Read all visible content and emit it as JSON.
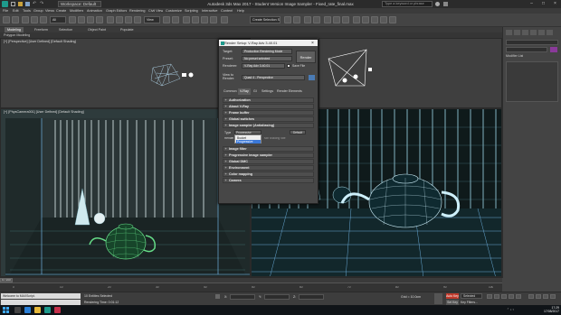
{
  "window": {
    "title": "Autodesk 3ds Max 2017 - Student Version     Image Sampler - Fixed_rate_final.max",
    "workspace": "Workspace: Default",
    "search_placeholder": "Type a keyword or phrase",
    "controls": [
      "–",
      "□",
      "×"
    ]
  },
  "menu": [
    "File",
    "Edit",
    "Tools",
    "Group",
    "Views",
    "Create",
    "Modifiers",
    "Animation",
    "Graph Editors",
    "Rendering",
    "Civil View",
    "Customize",
    "Scripting",
    "Interactive",
    "Content",
    "Help"
  ],
  "toolbar": {
    "filter": "All",
    "view": "View",
    "selection_set": "Create Selection Se"
  },
  "ribbon": {
    "tabs": [
      "Modeling",
      "Freeform",
      "Selection",
      "Object Paint",
      "Populate"
    ],
    "active_tab": 0,
    "subtitle": "Polygon Modeling"
  },
  "viewports": {
    "top_left": "[+] [Perspective] [User Defined] [Default Shading]",
    "bottom_left": "[+] [PhysCamera001] [User Defined] [Default Shading]"
  },
  "render_setup": {
    "title": "Render Setup: V-Ray Adv 3.40.01",
    "target_label": "Target:",
    "target_value": "Production Rendering Mode",
    "preset_label": "Preset:",
    "preset_value": "No preset selected",
    "renderer_label": "Renderer:",
    "renderer_value": "V-Ray Adv 3.40.01",
    "save_file": "Save File",
    "view_label": "View to Render:",
    "view_value": "Quad 4 - Perspective",
    "render_button": "Render",
    "tabs": [
      "Common",
      "V-Ray",
      "GI",
      "Settings",
      "Render Elements"
    ],
    "active_tab": 1,
    "rollouts_top": [
      "Authorization",
      "About V-Ray",
      "Frame buffer",
      "Global switches",
      "Image sampler (Antialiasing)"
    ],
    "type_label": "Type",
    "type_value": "Progressive",
    "render_mask_label": "Render mask",
    "default_btn": "Default",
    "dropdown_options": [
      "Bucket",
      "Progressive"
    ],
    "dropdown_highlight": 1,
    "min_rate_label": "Min shading rate",
    "rollouts_bottom": [
      "Image filter",
      "Progressive image sampler",
      "Global DMC",
      "Environment",
      "Color mapping",
      "Camera"
    ]
  },
  "right_panel": {
    "modifier_list": "Modifier List"
  },
  "status": {
    "maxscript": "Welcome to MAXScript.",
    "entities": "10 Entities Selected",
    "render_time": "Rendering Time: 0:01:12",
    "x_label": "X:",
    "y_label": "Y:",
    "z_label": "Z:",
    "grid": "Grid = 10.0cm",
    "auto_key": "Auto Key",
    "selected": "Selected",
    "set_key": "Set Key",
    "key_filters": "Key Filters..."
  },
  "timeline": {
    "position": "0 / 100",
    "ticks": [
      "0",
      "10",
      "20",
      "30",
      "40",
      "50",
      "60",
      "70",
      "80",
      "90",
      "100"
    ]
  },
  "clock": {
    "time": "17:29",
    "date": "17/08/2017"
  },
  "colors": {
    "accent": "#3b78d8",
    "autokey": "#c0392b",
    "wire": "#7ec9ff",
    "teapot": "#66dd88",
    "render_bg": "#0d1212"
  }
}
